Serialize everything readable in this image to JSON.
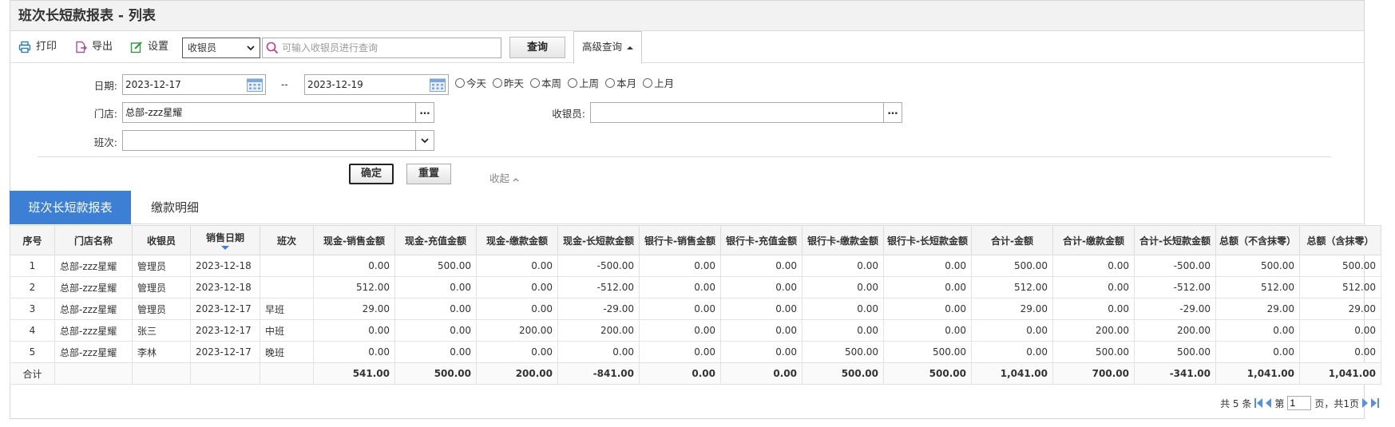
{
  "page": {
    "title": "班次长短款报表 - 列表"
  },
  "toolbar": {
    "print_label": "打印",
    "export_label": "导出",
    "settings_label": "设置",
    "search_field_select": "收银员",
    "search_placeholder": "可输入收银员进行查询",
    "query_label": "查询",
    "advanced_label": "高级查询"
  },
  "filter": {
    "date_label": "日期:",
    "date_from": "2023-12-17",
    "date_sep": "--",
    "date_to": "2023-12-19",
    "ranges": [
      "今天",
      "昨天",
      "本周",
      "上周",
      "本月",
      "上月"
    ],
    "store_label": "门店:",
    "store_value": "总部-zzz星耀",
    "cashier_label": "收银员:",
    "cashier_value": "",
    "shift_label": "班次:",
    "shift_value": "",
    "ok_label": "确定",
    "reset_label": "重置",
    "collapse_label": "收起"
  },
  "tabs": [
    "班次长短款报表",
    "缴款明细"
  ],
  "table": {
    "columns": [
      "序号",
      "门店名称",
      "收银员",
      "销售日期",
      "班次",
      "现金-销售金额",
      "现金-充值金额",
      "现金-缴款金额",
      "现金-长短款金额",
      "银行卡-销售金额",
      "银行卡-充值金额",
      "银行卡-缴款金额",
      "银行卡-长短款金额",
      "合计-金额",
      "合计-缴款金额",
      "合计-长短款金额",
      "总额（不含抹零）",
      "总额（含抹零）"
    ],
    "rows": [
      [
        "1",
        "总部-zzz星耀",
        "管理员",
        "2023-12-18",
        "",
        "0.00",
        "500.00",
        "0.00",
        "-500.00",
        "0.00",
        "0.00",
        "0.00",
        "0.00",
        "500.00",
        "0.00",
        "-500.00",
        "500.00",
        "500.00"
      ],
      [
        "2",
        "总部-zzz星耀",
        "管理员",
        "2023-12-18",
        "",
        "512.00",
        "0.00",
        "0.00",
        "-512.00",
        "0.00",
        "0.00",
        "0.00",
        "0.00",
        "512.00",
        "0.00",
        "-512.00",
        "512.00",
        "512.00"
      ],
      [
        "3",
        "总部-zzz星耀",
        "管理员",
        "2023-12-17",
        "早班",
        "29.00",
        "0.00",
        "0.00",
        "-29.00",
        "0.00",
        "0.00",
        "0.00",
        "0.00",
        "29.00",
        "0.00",
        "-29.00",
        "29.00",
        "29.00"
      ],
      [
        "4",
        "总部-zzz星耀",
        "张三",
        "2023-12-17",
        "中班",
        "0.00",
        "0.00",
        "200.00",
        "200.00",
        "0.00",
        "0.00",
        "0.00",
        "0.00",
        "0.00",
        "200.00",
        "200.00",
        "0.00",
        "0.00"
      ],
      [
        "5",
        "总部-zzz星耀",
        "李林",
        "2023-12-17",
        "晚班",
        "0.00",
        "0.00",
        "0.00",
        "0.00",
        "0.00",
        "0.00",
        "500.00",
        "500.00",
        "0.00",
        "500.00",
        "500.00",
        "0.00",
        "0.00"
      ]
    ],
    "total": [
      "合计",
      "",
      "",
      "",
      "",
      "541.00",
      "500.00",
      "200.00",
      "-841.00",
      "0.00",
      "0.00",
      "500.00",
      "500.00",
      "1,041.00",
      "700.00",
      "-341.00",
      "1,041.00",
      "1,041.00"
    ]
  },
  "pager": {
    "count_text": "共 5 条",
    "page_prefix": "第",
    "page_value": "1",
    "page_suffix": "页，共1页"
  },
  "colors": {
    "accent": "#3e7fd6",
    "header_bg": "#f2f2f2"
  }
}
